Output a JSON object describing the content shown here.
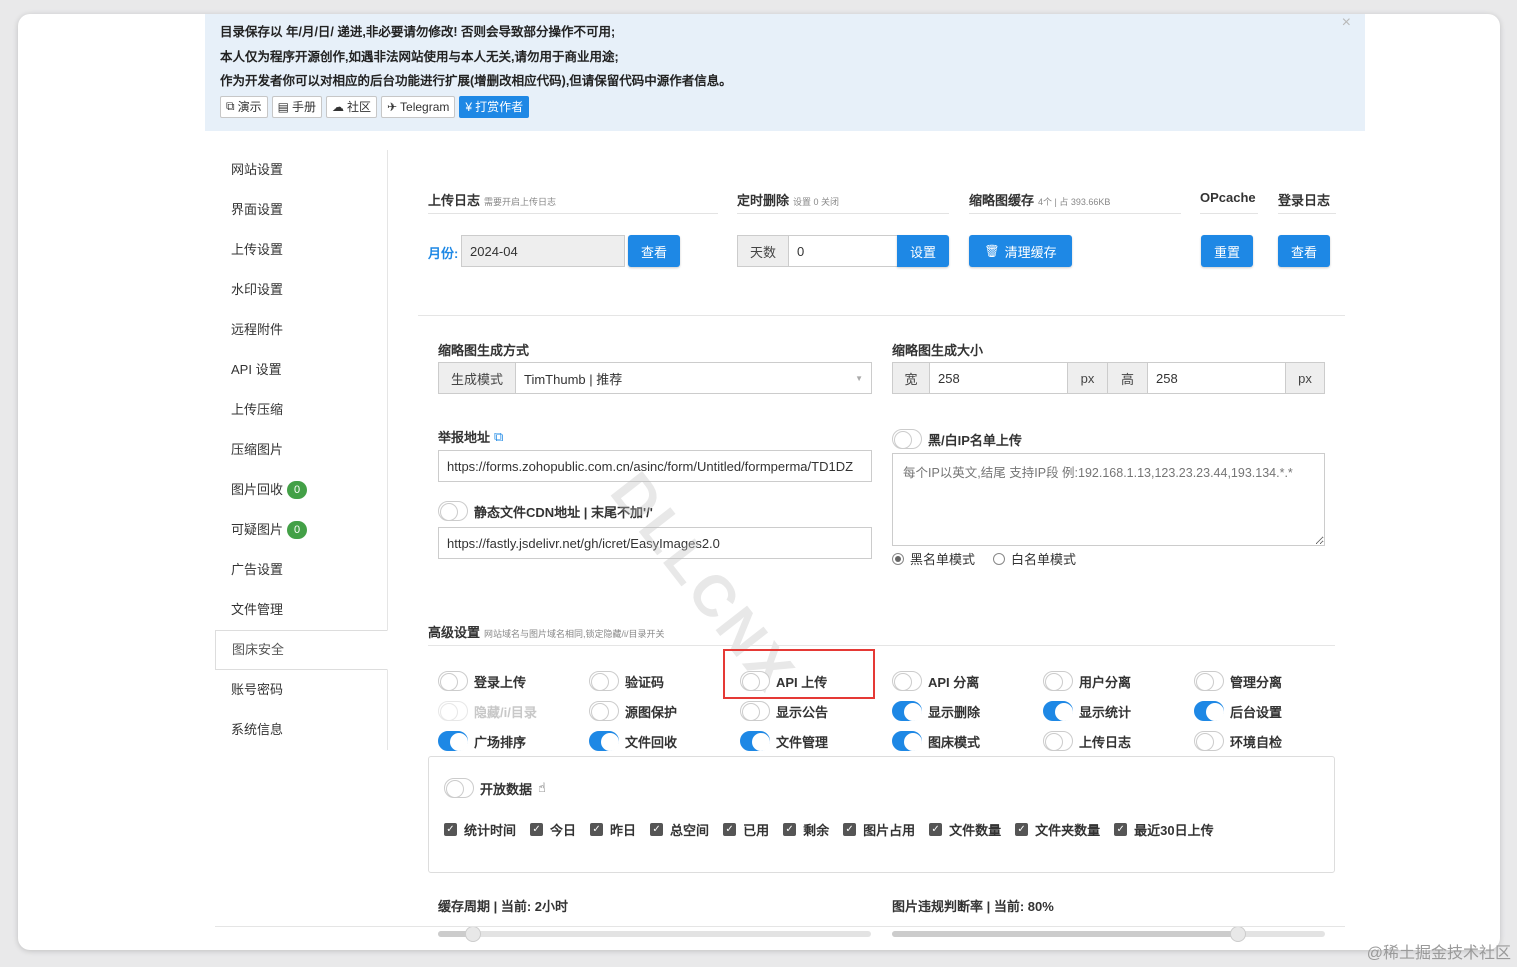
{
  "notice": {
    "lines": [
      "目录保存以 年/月/日/ 递进,非必要请勿修改! 否则会导致部分操作不可用;",
      "本人仅为程序开源创作,如遇非法网站使用与本人无关,请勿用于商业用途;",
      "作为开发者你可以对相应的后台功能进行扩展(增删改相应代码),但请保留代码中源作者信息。"
    ],
    "close": "×",
    "buttons": [
      {
        "icon": "external-link-icon",
        "glyph": "⧉",
        "label": "演示"
      },
      {
        "icon": "book-icon",
        "glyph": "▤",
        "label": "手册"
      },
      {
        "icon": "comments-icon",
        "glyph": "☁",
        "label": "社区"
      },
      {
        "icon": "plane-icon",
        "glyph": "✈",
        "label": "Telegram"
      },
      {
        "icon": "yen-icon",
        "glyph": "¥",
        "label": "打赏作者"
      }
    ]
  },
  "sidebar": {
    "items": [
      {
        "label": "网站设置"
      },
      {
        "label": "界面设置"
      },
      {
        "label": "上传设置"
      },
      {
        "label": "水印设置"
      },
      {
        "label": "远程附件"
      },
      {
        "label": "API 设置"
      },
      {
        "label": "上传压缩"
      },
      {
        "label": "压缩图片"
      },
      {
        "label": "图片回收",
        "badge": "0"
      },
      {
        "label": "可疑图片",
        "badge": "0"
      },
      {
        "label": "广告设置"
      },
      {
        "label": "文件管理"
      },
      {
        "label": "图床安全"
      },
      {
        "label": "账号密码"
      },
      {
        "label": "系统信息"
      }
    ]
  },
  "upload_log": {
    "title": "上传日志",
    "hint": "需要开启上传日志",
    "month_label": "月份:",
    "month_value": "2024-04",
    "view_button": "查看"
  },
  "auto_delete": {
    "title": "定时删除",
    "hint": "设置 0 关闭",
    "days_label": "天数",
    "days_value": "0",
    "set_button": "设置"
  },
  "thumb_cache": {
    "title": "缩略图缓存",
    "hint": "4个 | 占 393.66KB",
    "clear_button": "清理缓存"
  },
  "opcache": {
    "title": "OPcache",
    "reset_button": "重置"
  },
  "login_log": {
    "title": "登录日志",
    "view_button": "查看"
  },
  "thumb_mode": {
    "title": "缩略图生成方式",
    "addon": "生成模式",
    "value": "TimThumb | 推荐"
  },
  "thumb_size": {
    "title": "缩略图生成大小",
    "width_label": "宽",
    "width_value": "258",
    "unit": "px",
    "height_label": "高",
    "height_value": "258"
  },
  "report": {
    "title": "举报地址",
    "value": "https://forms.zohopublic.com.cn/asinc/form/Untitled/formperma/TD1DZ"
  },
  "cdn": {
    "title": "静态文件CDN地址 | 末尾不加'/'",
    "value": "https://fastly.jsdelivr.net/gh/icret/EasyImages2.0"
  },
  "ip_list": {
    "title": "黑/白IP名单上传",
    "placeholder": "每个IP以英文,结尾 支持IP段 例:192.168.1.13,123.23.23.44,193.134.*.*",
    "black_mode": "黑名单模式",
    "white_mode": "白名单模式"
  },
  "watermark": "DLLCNX",
  "advanced": {
    "title": "高级设置",
    "hint": "网站域名与图片域名相同,锁定隐藏/i/目录开关",
    "toggles": [
      {
        "label": "登录上传",
        "state": "off"
      },
      {
        "label": "验证码",
        "state": "off"
      },
      {
        "label": "API 上传",
        "state": "off"
      },
      {
        "label": "API 分离",
        "state": "off"
      },
      {
        "label": "用户分离",
        "state": "off"
      },
      {
        "label": "管理分离",
        "state": "off"
      },
      {
        "label": "隐藏/i/目录",
        "state": "disabled"
      },
      {
        "label": "源图保护",
        "state": "off"
      },
      {
        "label": "显示公告",
        "state": "off"
      },
      {
        "label": "显示删除",
        "state": "on"
      },
      {
        "label": "显示统计",
        "state": "on"
      },
      {
        "label": "后台设置",
        "state": "on"
      },
      {
        "label": "广场排序",
        "state": "on"
      },
      {
        "label": "文件回收",
        "state": "on"
      },
      {
        "label": "文件管理",
        "state": "on"
      },
      {
        "label": "图床模式",
        "state": "on"
      },
      {
        "label": "上传日志",
        "state": "off"
      },
      {
        "label": "环境自检",
        "state": "off"
      }
    ]
  },
  "open_data": {
    "title": "开放数据",
    "checks": [
      "统计时间",
      "今日",
      "昨日",
      "总空间",
      "已用",
      "剩余",
      "图片占用",
      "文件数量",
      "文件夹数量",
      "最近30日上传"
    ]
  },
  "cache_period": {
    "title": "缓存周期 | 当前: 2小时",
    "level": 0.08
  },
  "violation_rate": {
    "title": "图片违规判断率 | 当前: 80%",
    "level": 0.8
  },
  "corner_watermark": "@稀土掘金技术社区"
}
